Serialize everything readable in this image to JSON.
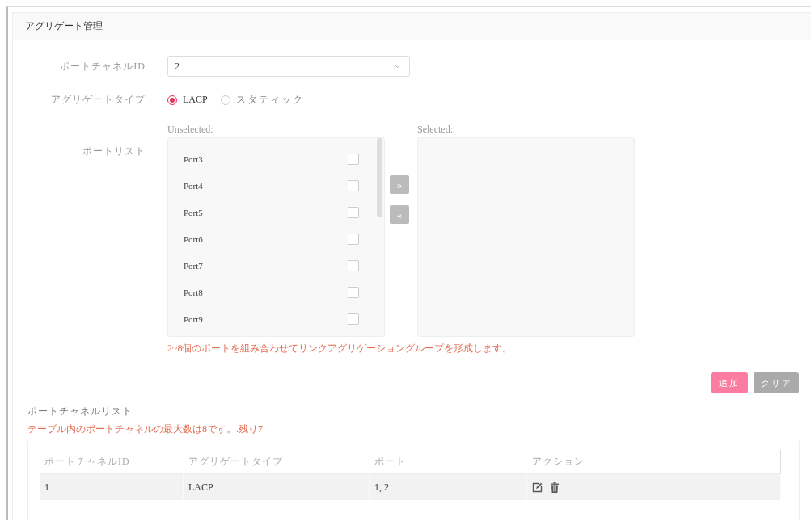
{
  "panel": {
    "title": "アグリゲート管理"
  },
  "form": {
    "channel_id": {
      "label": "ポートチャネルID",
      "value": "2"
    },
    "aggregate_type": {
      "label": "アグリゲートタイプ",
      "options": [
        {
          "label": "LACP",
          "selected": true
        },
        {
          "label": "スタティック",
          "selected": false
        }
      ]
    },
    "port_list": {
      "label": "ポートリスト",
      "unselected_title": "Unselected:",
      "selected_title": "Selected:",
      "unselected": [
        {
          "label": "Port3",
          "checked": false
        },
        {
          "label": "Port4",
          "checked": false
        },
        {
          "label": "Port5",
          "checked": false
        },
        {
          "label": "Port6",
          "checked": false
        },
        {
          "label": "Port7",
          "checked": false
        },
        {
          "label": "Port8",
          "checked": false
        },
        {
          "label": "Port9",
          "checked": false
        }
      ],
      "move_buttons": [
        {
          "label": "»"
        },
        {
          "label": "«"
        }
      ],
      "hint": "2~8個のポートを組み合わせてリンクアグリゲーショングループを形成します。"
    },
    "buttons": [
      {
        "label": "追加",
        "kind": "primary"
      },
      {
        "label": "クリア",
        "kind": "secondary"
      }
    ]
  },
  "channel_list": {
    "title": "ポートチャネルリスト",
    "note": "テーブル内のポートチャネルの最大数は8です。.残り7",
    "columns": [
      "ポートチャネルID",
      "アグリゲートタイプ",
      "ポート",
      "アクション"
    ],
    "rows": [
      {
        "cells": [
          "1",
          "LACP",
          "1, 2"
        ]
      }
    ]
  }
}
